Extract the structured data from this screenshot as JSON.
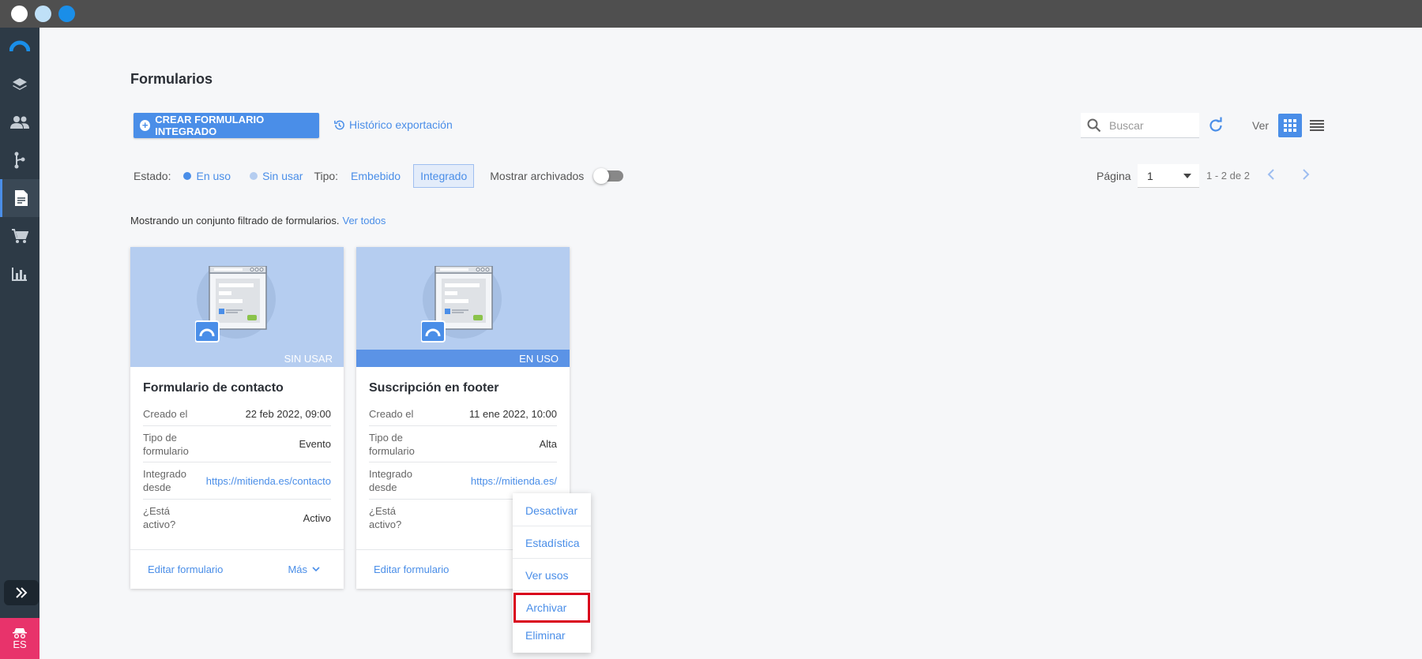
{
  "window": {
    "dots": [
      "#ffffff",
      "#bfe0f7",
      "#1a8ee8"
    ]
  },
  "sidebar": {
    "items": [
      {
        "icon": "logo-icon"
      },
      {
        "icon": "layers-icon"
      },
      {
        "icon": "people-icon"
      },
      {
        "icon": "branch-icon"
      },
      {
        "icon": "document-icon",
        "active": true
      },
      {
        "icon": "cart-icon"
      },
      {
        "icon": "bar-chart-icon"
      }
    ],
    "lang": "ES"
  },
  "page": {
    "title": "Formularios"
  },
  "toolbar": {
    "create_label": "CREAR FORMULARIO INTEGRADO",
    "history_label": "Histórico exportación",
    "search_placeholder": "Buscar",
    "view_label": "Ver"
  },
  "filters": {
    "estado_label": "Estado:",
    "en_uso": "En uso",
    "sin_usar": "Sin usar",
    "tipo_label": "Tipo:",
    "embebido": "Embebido",
    "integrado": "Integrado",
    "archivados_label": "Mostrar archivados"
  },
  "pagination": {
    "label": "Página",
    "current": "1",
    "count": "1 - 2 de 2"
  },
  "filter_message": {
    "text": "Mostrando un conjunto filtrado de formularios.",
    "link": "Ver todos"
  },
  "cards": [
    {
      "status": "SIN USAR",
      "title": "Formulario de contacto",
      "rows": [
        {
          "k1": "Creado el",
          "k2": "",
          "v": "22 feb 2022, 09:00"
        },
        {
          "k1": "Tipo de",
          "k2": "formulario",
          "v": "Evento"
        },
        {
          "k1": "Integrado",
          "k2": "desde",
          "v": "https://mitienda.es/contacto"
        },
        {
          "k1": "¿Está",
          "k2": "activo?",
          "v": "Activo"
        }
      ],
      "edit": "Editar formulario",
      "more": "Más"
    },
    {
      "status": "EN USO",
      "title": "Suscripción en footer",
      "rows": [
        {
          "k1": "Creado el",
          "k2": "",
          "v": "11 ene 2022, 10:00"
        },
        {
          "k1": "Tipo de",
          "k2": "formulario",
          "v": "Alta"
        },
        {
          "k1": "Integrado",
          "k2": "desde",
          "v": "https://mitienda.es/"
        },
        {
          "k1": "¿Está",
          "k2": "activo?",
          "v": ""
        }
      ],
      "edit": "Editar formulario"
    }
  ],
  "context_menu": {
    "items": [
      "Desactivar",
      "Estadística",
      "Ver usos",
      "Archivar",
      "Eliminar"
    ]
  }
}
